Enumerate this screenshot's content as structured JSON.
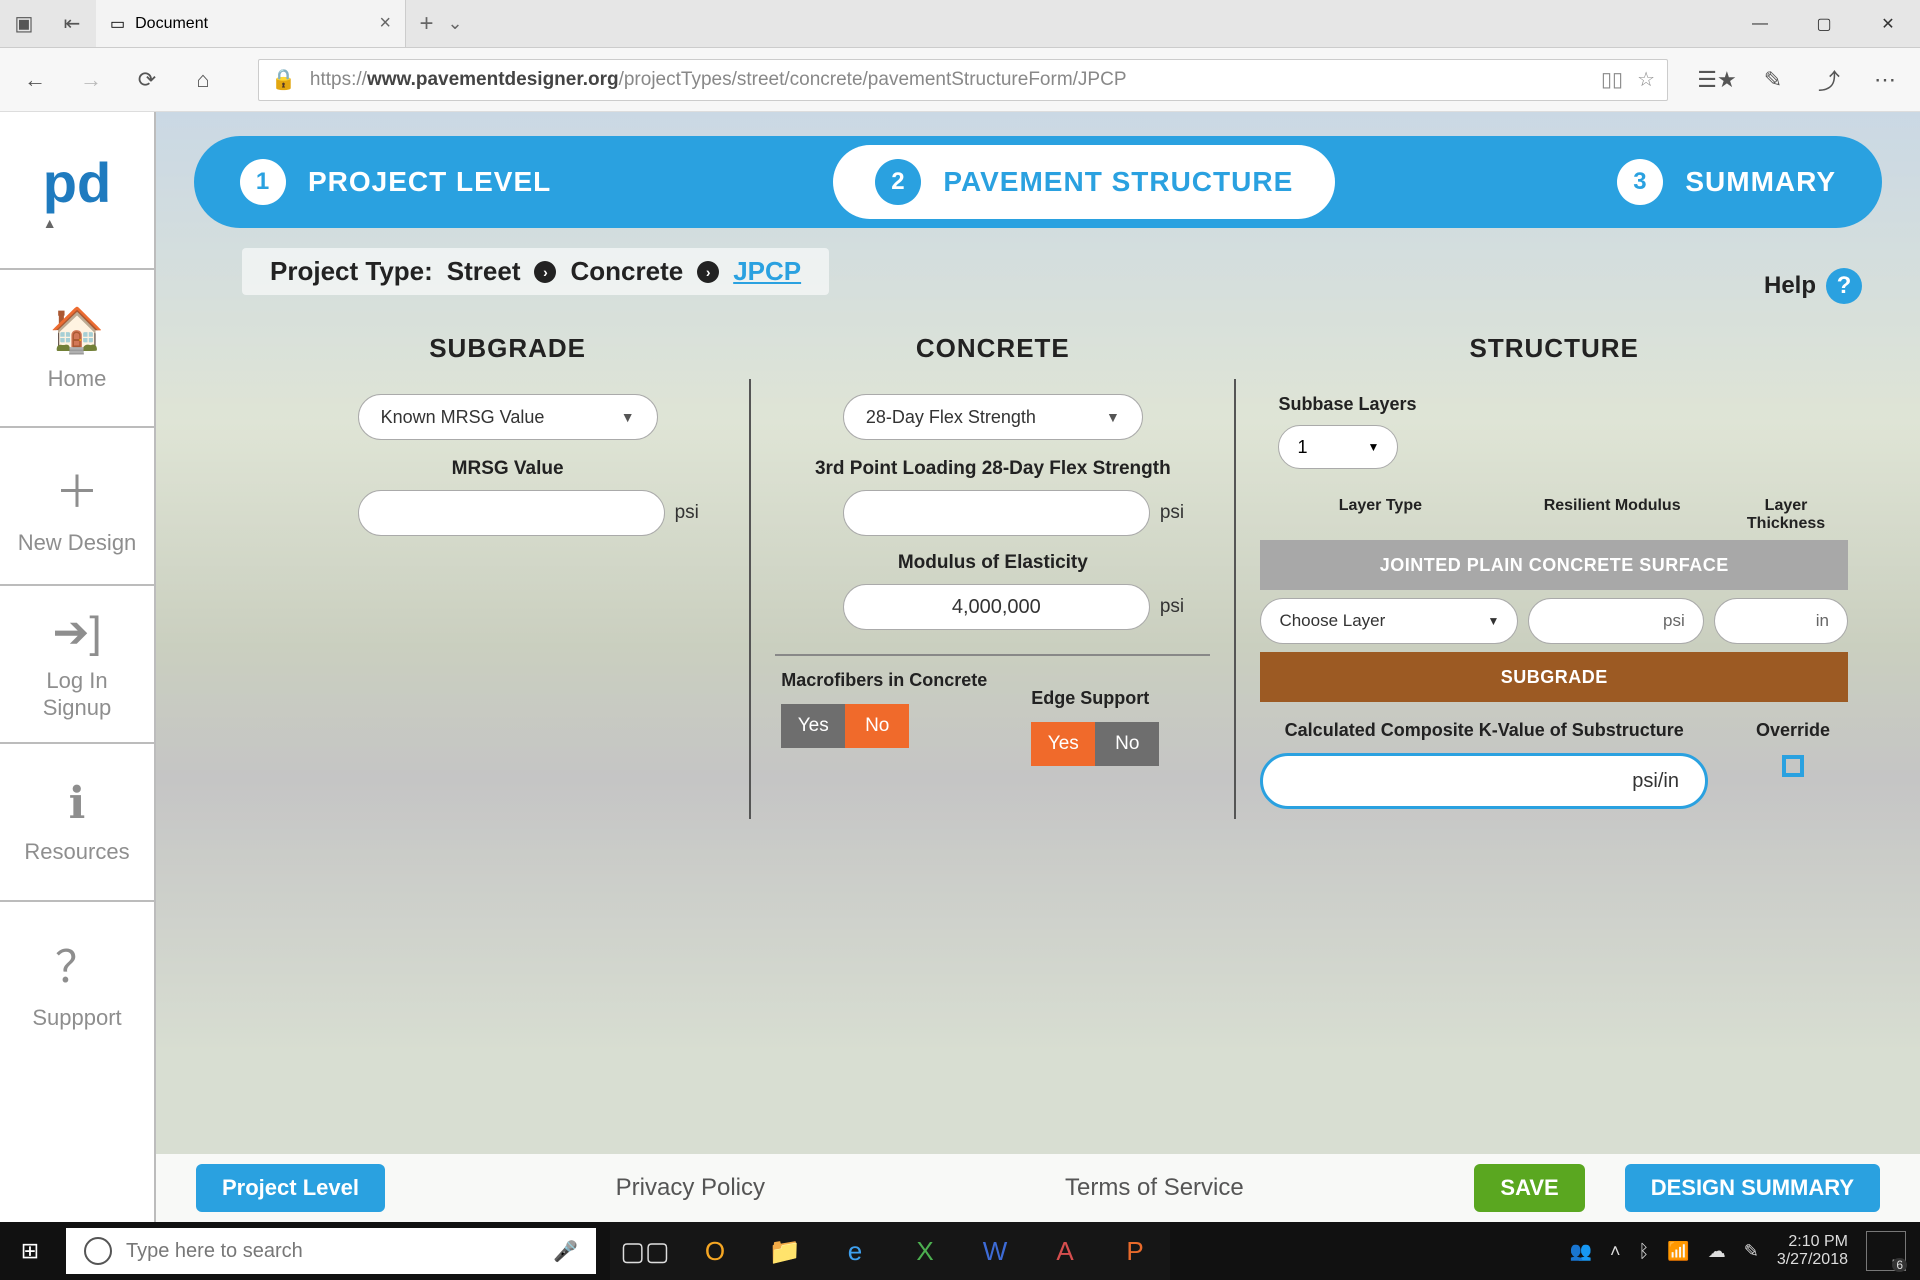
{
  "browser": {
    "tab_title": "Document",
    "url_prefix": "https://",
    "url_host": "www.pavementdesigner.org",
    "url_path": "/projectTypes/street/concrete/pavementStructureForm/JPCP"
  },
  "sidebar": {
    "items": [
      {
        "label": "Home"
      },
      {
        "label": "New Design"
      },
      {
        "label": "Log In\nSignup"
      },
      {
        "label": "Resources"
      },
      {
        "label": "Suppport"
      }
    ]
  },
  "stepper": {
    "steps": [
      {
        "num": "1",
        "label": "PROJECT LEVEL"
      },
      {
        "num": "2",
        "label": "PAVEMENT STRUCTURE"
      },
      {
        "num": "3",
        "label": "SUMMARY"
      }
    ],
    "active_index": 1
  },
  "breadcrumb": {
    "label": "Project Type:",
    "items": [
      "Street",
      "Concrete"
    ],
    "current": "JPCP"
  },
  "help_label": "Help",
  "columns": {
    "subgrade": {
      "title": "SUBGRADE",
      "dropdown": "Known MRSG Value",
      "field_label": "MRSG Value",
      "value": "",
      "unit": "psi"
    },
    "concrete": {
      "title": "CONCRETE",
      "dropdown": "28-Day Flex Strength",
      "flex_label": "3rd Point Loading 28-Day Flex Strength",
      "flex_value": "",
      "flex_unit": "psi",
      "modulus_label": "Modulus of Elasticity",
      "modulus_value": "4,000,000",
      "modulus_unit": "psi",
      "macro_label": "Macrofibers in Concrete",
      "edge_label": "Edge Support",
      "yes": "Yes",
      "no": "No"
    },
    "structure": {
      "title": "STRUCTURE",
      "subbase_label": "Subbase Layers",
      "subbase_count": "1",
      "hdr_type": "Layer Type",
      "hdr_mod": "Resilient Modulus",
      "hdr_thk": "Layer Thickness",
      "band_top": "JOINTED PLAIN CONCRETE SURFACE",
      "layer_select": "Choose Layer",
      "layer_mod_unit": "psi",
      "layer_thk_unit": "in",
      "band_bottom": "SUBGRADE",
      "kval_label": "Calculated Composite K-Value of Substructure",
      "kval_unit": "psi/in",
      "override_label": "Override"
    }
  },
  "footer": {
    "back": "Project Level",
    "privacy": "Privacy Policy",
    "terms": "Terms of Service",
    "save": "SAVE",
    "summary": "DESIGN SUMMARY"
  },
  "taskbar": {
    "search_placeholder": "Type here to search",
    "time": "2:10 PM",
    "date": "3/27/2018",
    "notif_count": "6"
  }
}
